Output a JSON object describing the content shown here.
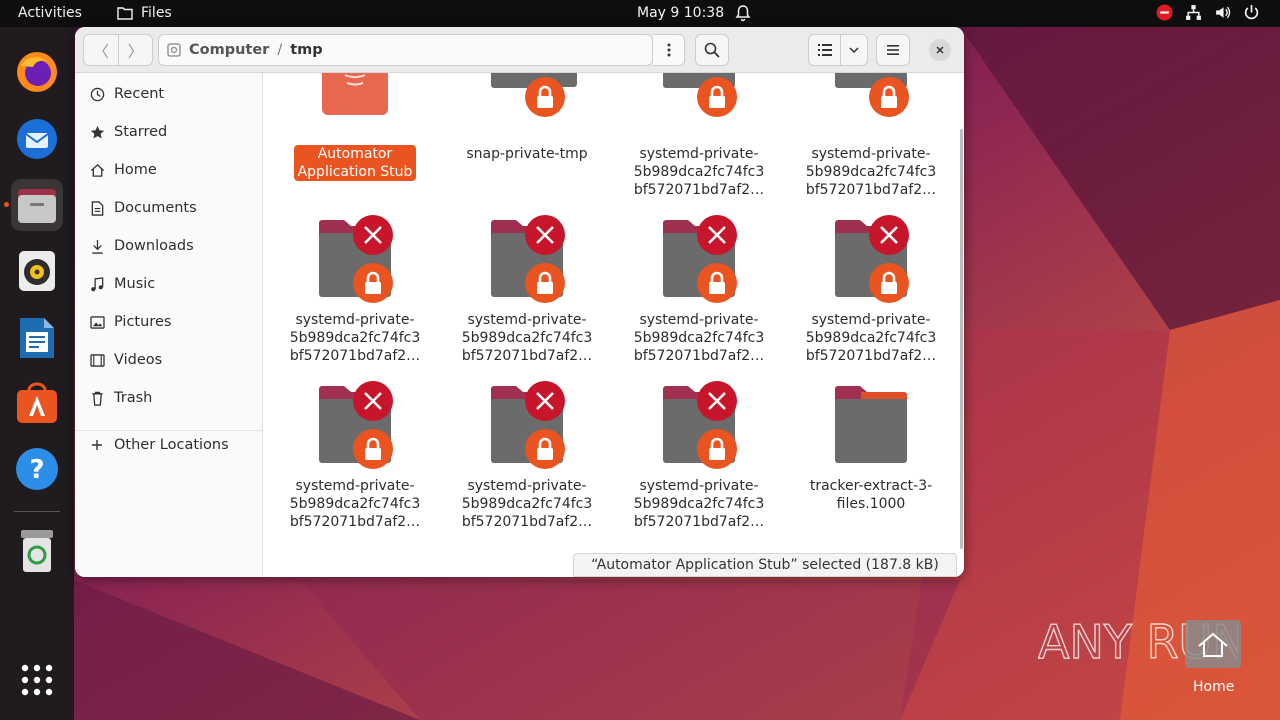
{
  "topbar": {
    "activities": "Activities",
    "app_name": "Files",
    "clock": "May 9  10:38",
    "tray_icons": [
      "do-not-disturb-icon",
      "network-icon",
      "volume-icon",
      "power-icon"
    ]
  },
  "dock": {
    "items": [
      {
        "name": "firefox",
        "icon": "firefox-icon"
      },
      {
        "name": "thunderbird",
        "icon": "thunderbird-icon"
      },
      {
        "name": "files",
        "icon": "files-icon",
        "active": true
      },
      {
        "name": "rhythmbox",
        "icon": "rhythmbox-icon"
      },
      {
        "name": "writer",
        "icon": "libreoffice-writer-icon"
      },
      {
        "name": "software",
        "icon": "app-center-icon"
      },
      {
        "name": "help",
        "icon": "help-icon"
      },
      {
        "name": "trash",
        "icon": "trash-icon"
      },
      {
        "name": "show-apps",
        "icon": "app-grid-icon"
      }
    ]
  },
  "window": {
    "path": {
      "root": "Computer",
      "separator": "/",
      "current": "tmp"
    },
    "sidebar": {
      "items": [
        {
          "label": "Recent",
          "icon": "clock-icon"
        },
        {
          "label": "Starred",
          "icon": "star-icon"
        },
        {
          "label": "Home",
          "icon": "home-icon"
        },
        {
          "label": "Documents",
          "icon": "document-icon"
        },
        {
          "label": "Downloads",
          "icon": "download-icon"
        },
        {
          "label": "Music",
          "icon": "music-icon"
        },
        {
          "label": "Pictures",
          "icon": "picture-icon"
        },
        {
          "label": "Videos",
          "icon": "video-icon"
        },
        {
          "label": "Trash",
          "icon": "trash-icon"
        },
        {
          "label": "Other Locations",
          "icon": "plus-icon"
        }
      ]
    },
    "files": [
      {
        "lines": [
          "Automator",
          "Application Stub"
        ],
        "kind": "java-app",
        "selected": true
      },
      {
        "lines": [
          "snap-private-tmp"
        ],
        "kind": "locked-folder"
      },
      {
        "lines": [
          "systemd-private-",
          "5b989dca2fc74fc3",
          "bf572071bd7af2…"
        ],
        "kind": "locked-folder"
      },
      {
        "lines": [
          "systemd-private-",
          "5b989dca2fc74fc3",
          "bf572071bd7af2…"
        ],
        "kind": "locked-folder"
      },
      {
        "lines": [
          "systemd-private-",
          "5b989dca2fc74fc3",
          "bf572071bd7af2…"
        ],
        "kind": "denied-folder"
      },
      {
        "lines": [
          "systemd-private-",
          "5b989dca2fc74fc3",
          "bf572071bd7af2…"
        ],
        "kind": "denied-folder"
      },
      {
        "lines": [
          "systemd-private-",
          "5b989dca2fc74fc3",
          "bf572071bd7af2…"
        ],
        "kind": "denied-folder"
      },
      {
        "lines": [
          "systemd-private-",
          "5b989dca2fc74fc3",
          "bf572071bd7af2…"
        ],
        "kind": "denied-folder"
      },
      {
        "lines": [
          "systemd-private-",
          "5b989dca2fc74fc3",
          "bf572071bd7af2…"
        ],
        "kind": "denied-folder"
      },
      {
        "lines": [
          "systemd-private-",
          "5b989dca2fc74fc3",
          "bf572071bd7af2…"
        ],
        "kind": "denied-folder"
      },
      {
        "lines": [
          "systemd-private-",
          "5b989dca2fc74fc3",
          "bf572071bd7af2…"
        ],
        "kind": "denied-folder"
      },
      {
        "lines": [
          "tracker-extract-3-",
          "files.1000"
        ],
        "kind": "folder"
      }
    ],
    "status": "“Automator Application Stub” selected  (187.8 kB)"
  },
  "desktop": {
    "watermark": "ANY RUN",
    "home_label": "Home"
  },
  "colors": {
    "accent": "#e95420",
    "denied": "#c7162b",
    "folder_body": "#6b6b6b",
    "folder_tab": "#a0304f"
  }
}
